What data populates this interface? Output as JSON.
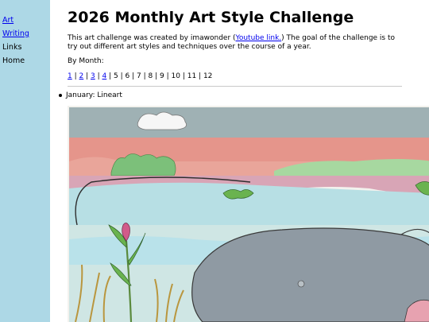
{
  "sidebar": {
    "items": [
      {
        "label": "Art",
        "link": true
      },
      {
        "label": "Writing",
        "link": true
      },
      {
        "label": "Links",
        "link": false
      },
      {
        "label": "Home",
        "link": false
      }
    ]
  },
  "header": {
    "title": "2026 Monthly Art Style Challenge"
  },
  "intro": {
    "text_before": "This art challenge was created by imawonder (",
    "link_text": "Youtube link.",
    "text_after": ") The goal of the challenge is to try out different art styles and techniques over the course of a year."
  },
  "by_month_label": "By Month:",
  "months": [
    {
      "label": "1",
      "link": true
    },
    {
      "label": "2",
      "link": true
    },
    {
      "label": "3",
      "link": true
    },
    {
      "label": "4",
      "link": true
    },
    {
      "label": "5",
      "link": false
    },
    {
      "label": "6",
      "link": false
    },
    {
      "label": "7",
      "link": false
    },
    {
      "label": "8",
      "link": false
    },
    {
      "label": "9",
      "link": false
    },
    {
      "label": "10",
      "link": false
    },
    {
      "label": "11",
      "link": false
    },
    {
      "label": "12",
      "link": false
    }
  ],
  "month_separator": " | ",
  "entries": [
    {
      "text": "January: Lineart"
    }
  ],
  "colors": {
    "sidebar_bg": "#add8e6",
    "link": "#0000ee"
  }
}
